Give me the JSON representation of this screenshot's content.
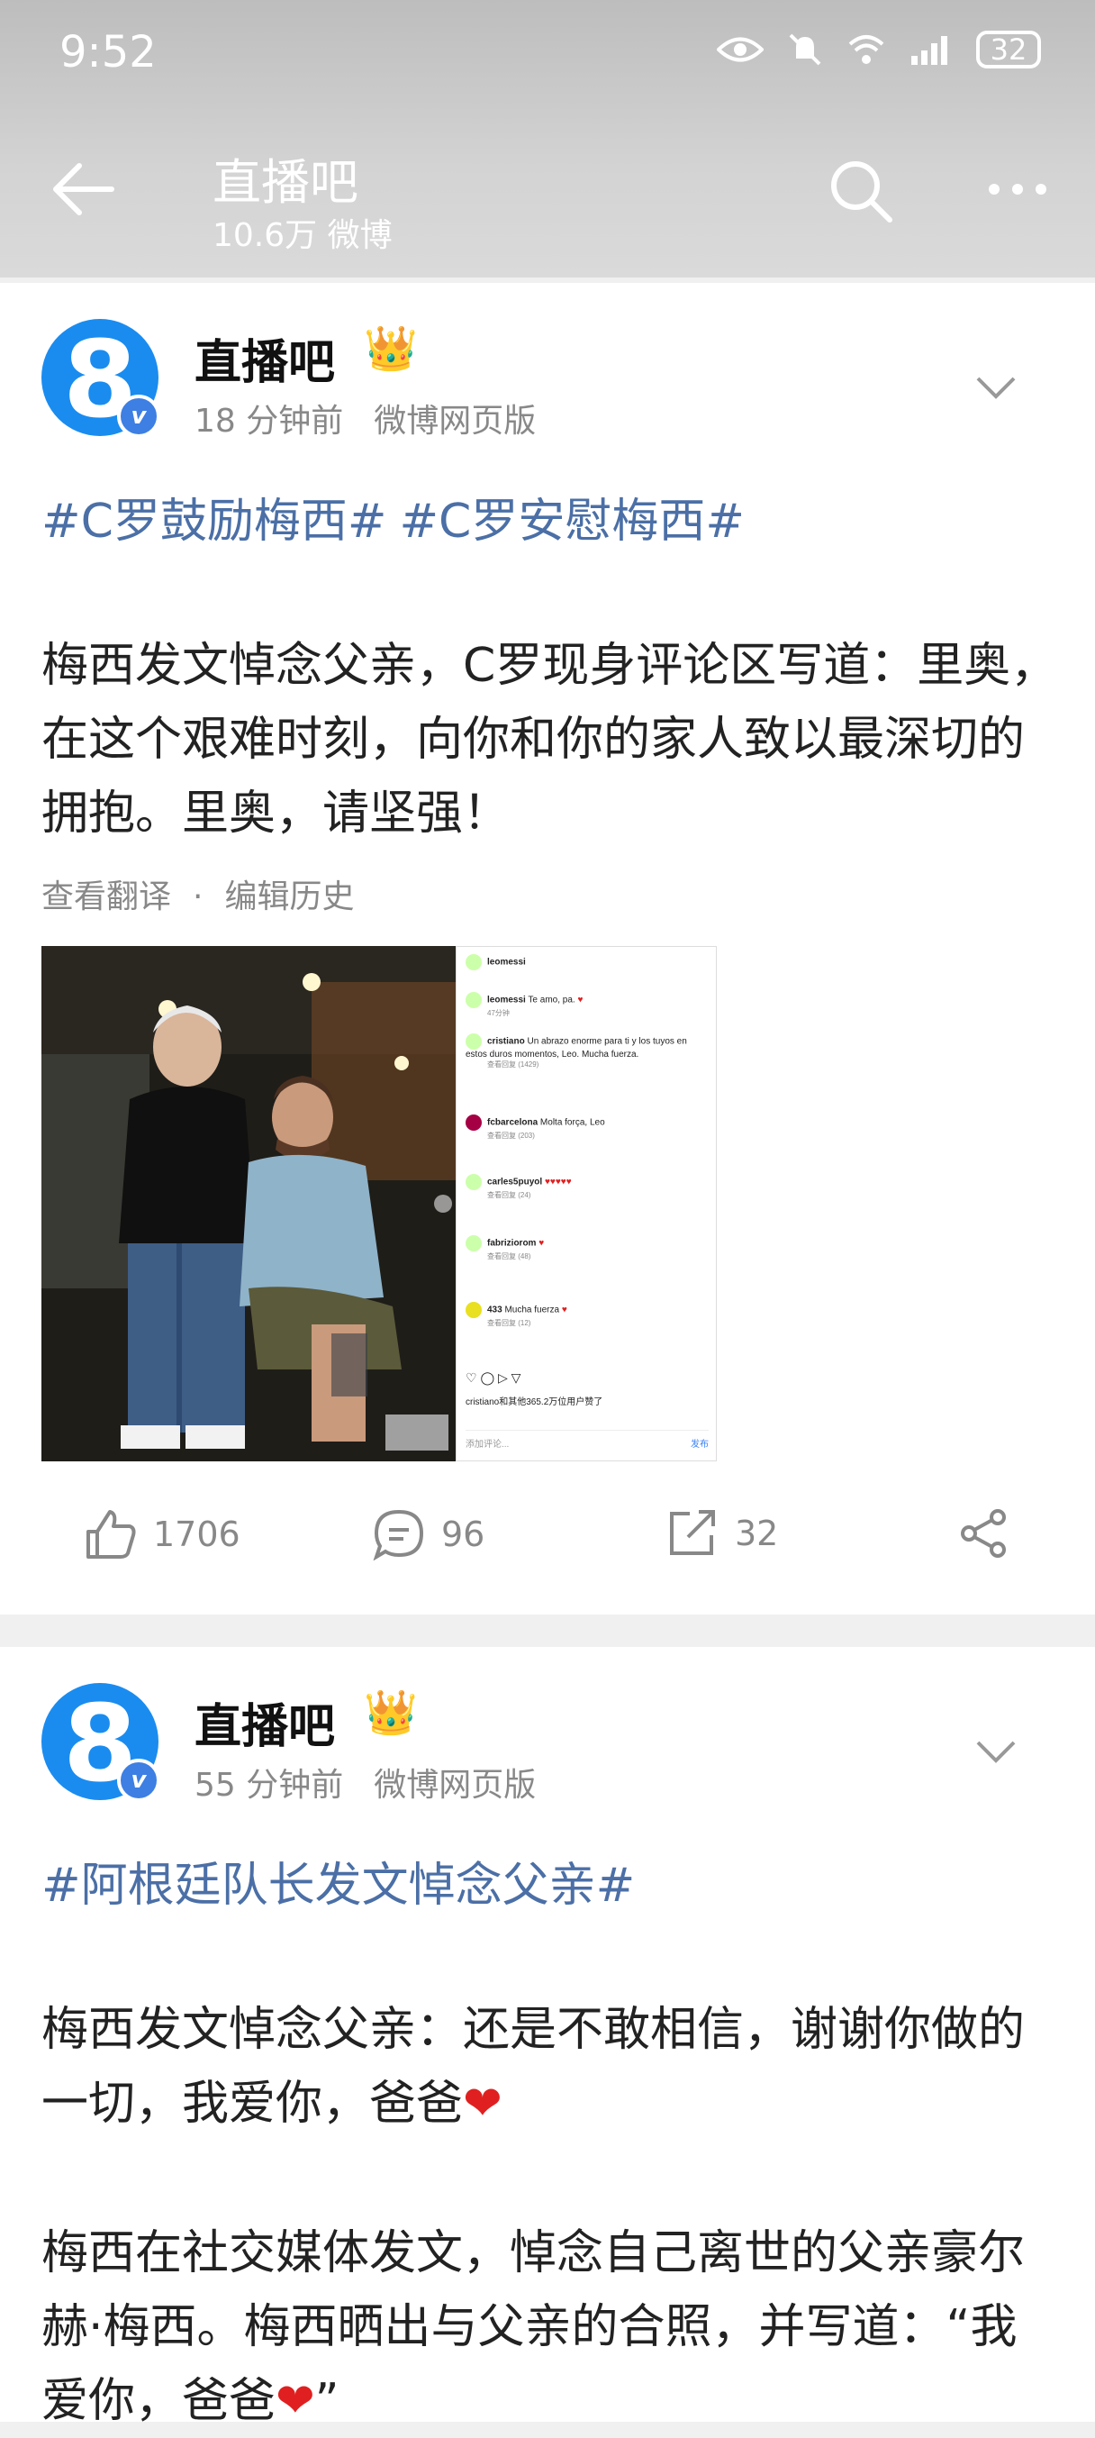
{
  "status": {
    "time": "9:52",
    "battery": "32"
  },
  "header": {
    "title": "直播吧",
    "subtitle": "10.6万 微博"
  },
  "posts": [
    {
      "author": "直播吧",
      "time": "18 分钟前",
      "source": "微博网页版",
      "tags": [
        "#C罗鼓励梅西#",
        "#C罗安慰梅西#"
      ],
      "text": "梅西发文悼念父亲，C罗现身评论区写道：里奥，在这个艰难时刻，向你和你的家人致以最深切的拥抱。里奥，请坚强！",
      "translate": "查看翻译",
      "dot": "·",
      "history": "编辑历史",
      "screenshot": {
        "top_user": "leomessi",
        "rows": [
          {
            "user": "leomessi",
            "text": "Te amo, pa.",
            "sub": "47分钟"
          },
          {
            "user": "cristiano",
            "text": "Un abrazo enorme para ti y los tuyos en estos duros momentos, Leo. Mucha fuerza.",
            "sub": "查看回复 (1429)"
          },
          {
            "user": "fcbarcelona",
            "text": "Molta força, Leo",
            "sub": "查看回复 (203)"
          },
          {
            "user": "carles5puyol",
            "text": "♥♥♥♥♥",
            "sub": "查看回复 (24)"
          },
          {
            "user": "fabriziorom",
            "text": "♥",
            "sub": "查看回复 (48)"
          },
          {
            "user": "433",
            "text": "Mucha fuerza",
            "sub": "查看回复 (12)"
          }
        ],
        "liked_by": "cristiano和其他365.2万位用户赞了",
        "comment_placeholder": "添加评论...",
        "post_label": "发布"
      },
      "actions": {
        "likes": "1706",
        "comments": "96",
        "reposts": "32"
      }
    },
    {
      "author": "直播吧",
      "time": "55 分钟前",
      "source": "微博网页版",
      "tags": [
        "#阿根廷队长发文悼念父亲#"
      ],
      "para1": "梅西发文悼念父亲：还是不敢相信，谢谢你做的一切，我爱你，爸爸",
      "para2": "梅西在社交媒体发文，悼念自己离世的父亲豪尔赫·梅西。梅西晒出与父亲的合照，并写道：“我爱你，爸爸",
      "para2_end": "”",
      "heart": "❤"
    }
  ],
  "icons": [
    "back-arrow-icon",
    "search-icon",
    "more-icon",
    "chevron-down-icon",
    "like-icon",
    "comment-icon",
    "repost-icon",
    "share-icon"
  ]
}
